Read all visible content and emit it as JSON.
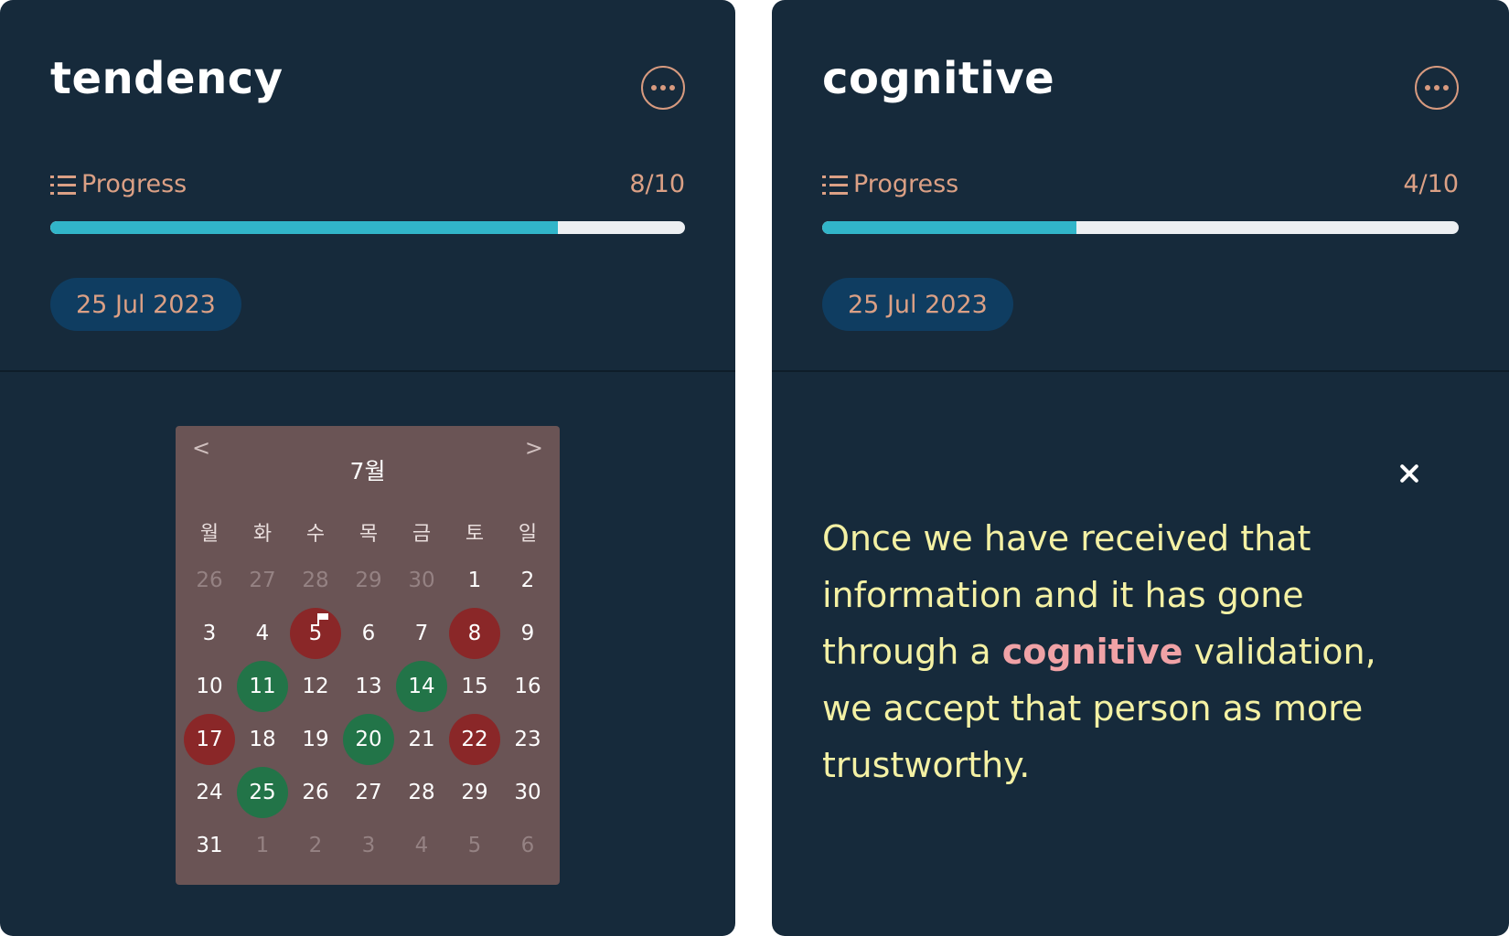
{
  "cards": [
    {
      "title": "tendency",
      "progress": {
        "label": "Progress",
        "count": "8/10",
        "value": 0.8
      },
      "date": "25 Jul 2023"
    },
    {
      "title": "cognitive",
      "progress": {
        "label": "Progress",
        "count": "4/10",
        "value": 0.4
      },
      "date": "25 Jul 2023"
    }
  ],
  "calendar": {
    "prev": "<",
    "next": ">",
    "month": "7월",
    "weekdays": [
      "월",
      "화",
      "수",
      "목",
      "금",
      "토",
      "일"
    ],
    "days": [
      {
        "n": "26",
        "other": true
      },
      {
        "n": "27",
        "other": true
      },
      {
        "n": "28",
        "other": true
      },
      {
        "n": "29",
        "other": true
      },
      {
        "n": "30",
        "other": true
      },
      {
        "n": "1"
      },
      {
        "n": "2"
      },
      {
        "n": "3"
      },
      {
        "n": "4"
      },
      {
        "n": "5",
        "status": "red",
        "flag": true
      },
      {
        "n": "6"
      },
      {
        "n": "7"
      },
      {
        "n": "8",
        "status": "red"
      },
      {
        "n": "9"
      },
      {
        "n": "10"
      },
      {
        "n": "11",
        "status": "green"
      },
      {
        "n": "12"
      },
      {
        "n": "13"
      },
      {
        "n": "14",
        "status": "green"
      },
      {
        "n": "15"
      },
      {
        "n": "16"
      },
      {
        "n": "17",
        "status": "red"
      },
      {
        "n": "18"
      },
      {
        "n": "19"
      },
      {
        "n": "20",
        "status": "green"
      },
      {
        "n": "21"
      },
      {
        "n": "22",
        "status": "red"
      },
      {
        "n": "23"
      },
      {
        "n": "24"
      },
      {
        "n": "25",
        "status": "green"
      },
      {
        "n": "26"
      },
      {
        "n": "27"
      },
      {
        "n": "28"
      },
      {
        "n": "29"
      },
      {
        "n": "30"
      },
      {
        "n": "31"
      },
      {
        "n": "1",
        "other": true
      },
      {
        "n": "2",
        "other": true
      },
      {
        "n": "3",
        "other": true
      },
      {
        "n": "4",
        "other": true
      },
      {
        "n": "5",
        "other": true
      },
      {
        "n": "6",
        "other": true
      }
    ]
  },
  "quote": {
    "before": "Once we have received that information and it has gone through a ",
    "highlight": "cognitive",
    "after": " validation, we accept that person as more trustworthy."
  },
  "colors": {
    "card_bg": "#162a3b",
    "accent": "#dba085",
    "progress_fill": "#31b5c9",
    "red_day": "#8a2728",
    "green_day": "#227448",
    "quote_text": "#f4f1a4",
    "quote_highlight": "#f0a2a6"
  }
}
